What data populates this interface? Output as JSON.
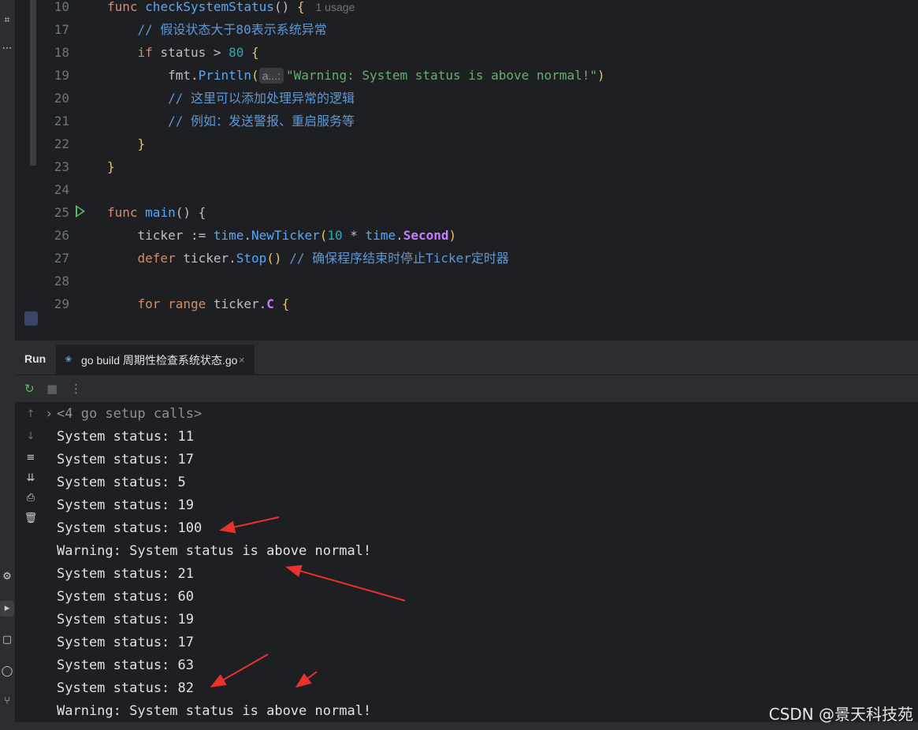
{
  "editor": {
    "lines": [
      {
        "num": "10",
        "parts": [
          [
            "kw",
            "func "
          ],
          [
            "fn",
            "checkSystemStatus"
          ],
          [
            "pkg",
            "() "
          ],
          [
            "yel",
            "{"
          ]
        ],
        "hint_usage": "1 usage"
      },
      {
        "num": "17",
        "parts": [
          [
            "cmt",
            "    // 假设状态大于80表示系统异常"
          ]
        ]
      },
      {
        "num": "18",
        "parts": [
          [
            "kw",
            "    if "
          ],
          [
            "pkg",
            "status > "
          ],
          [
            "num",
            "80"
          ],
          [
            "pkg",
            " "
          ],
          [
            "yel",
            "{"
          ]
        ]
      },
      {
        "num": "19",
        "parts": [
          [
            "pkg",
            "        fmt."
          ],
          [
            "call",
            "Println"
          ],
          [
            "paren-hl",
            "("
          ]
        ],
        "inlay": "a...:",
        "after": [
          [
            "str",
            "\"Warning: System status is above normal!\""
          ],
          [
            "paren-hl",
            ")"
          ]
        ]
      },
      {
        "num": "20",
        "parts": [
          [
            "cmt",
            "        // 这里可以添加处理异常的逻辑"
          ]
        ]
      },
      {
        "num": "21",
        "parts": [
          [
            "cmt",
            "        // 例如：发送警报、重启服务等"
          ]
        ]
      },
      {
        "num": "22",
        "parts": [
          [
            "yel",
            "    }"
          ]
        ]
      },
      {
        "num": "23",
        "parts": [
          [
            "yel",
            "}"
          ]
        ]
      },
      {
        "num": "24",
        "parts": []
      },
      {
        "num": "25",
        "parts": [
          [
            "kw",
            "func "
          ],
          [
            "fn",
            "main"
          ],
          [
            "pkg",
            "() "
          ],
          [
            "pkg",
            "{"
          ]
        ],
        "run_marker": true
      },
      {
        "num": "26",
        "parts": [
          [
            "pkg",
            "    ticker := "
          ],
          [
            "call",
            "time"
          ],
          [
            "pkg",
            "."
          ],
          [
            "call",
            "NewTicker"
          ],
          [
            "paren-hl",
            "("
          ],
          [
            "num",
            "10"
          ],
          [
            "pkg",
            " * "
          ],
          [
            "call",
            "time"
          ],
          [
            "pkg",
            "."
          ],
          [
            "prop",
            "Second"
          ],
          [
            "paren-hl",
            ")"
          ]
        ]
      },
      {
        "num": "27",
        "parts": [
          [
            "kw",
            "    defer "
          ],
          [
            "pkg",
            "ticker."
          ],
          [
            "call",
            "Stop"
          ],
          [
            "paren-hl",
            "()"
          ],
          [
            "cmt",
            " // 确保程序结束时停止Ticker定时器"
          ]
        ]
      },
      {
        "num": "28",
        "parts": []
      },
      {
        "num": "29",
        "parts": [
          [
            "kw",
            "    for "
          ],
          [
            "kw",
            "range "
          ],
          [
            "pkg",
            "ticker."
          ],
          [
            "prop",
            "C"
          ],
          [
            "pkg",
            " "
          ],
          [
            "yel",
            "{"
          ]
        ]
      }
    ]
  },
  "run_panel": {
    "title": "Run",
    "tab_label": "go build 周期性检查系统状态.go",
    "tab_close": "×",
    "setup_calls": "<4 go setup calls>",
    "output": [
      "System status: 11",
      "System status: 17",
      "System status: 5",
      "System status: 19",
      "System status: 100",
      "Warning: System status is above normal!",
      "System status: 21",
      "System status: 60",
      "System status: 19",
      "System status: 17",
      "System status: 63",
      "System status: 82",
      "Warning: System status is above normal!"
    ]
  },
  "icons": {
    "rerun": "rerun-icon",
    "stop": "stop-icon",
    "more": "more-icon"
  },
  "colors": {
    "annotation_arrow": "#e8322b"
  },
  "watermark": "CSDN @景天科技苑"
}
